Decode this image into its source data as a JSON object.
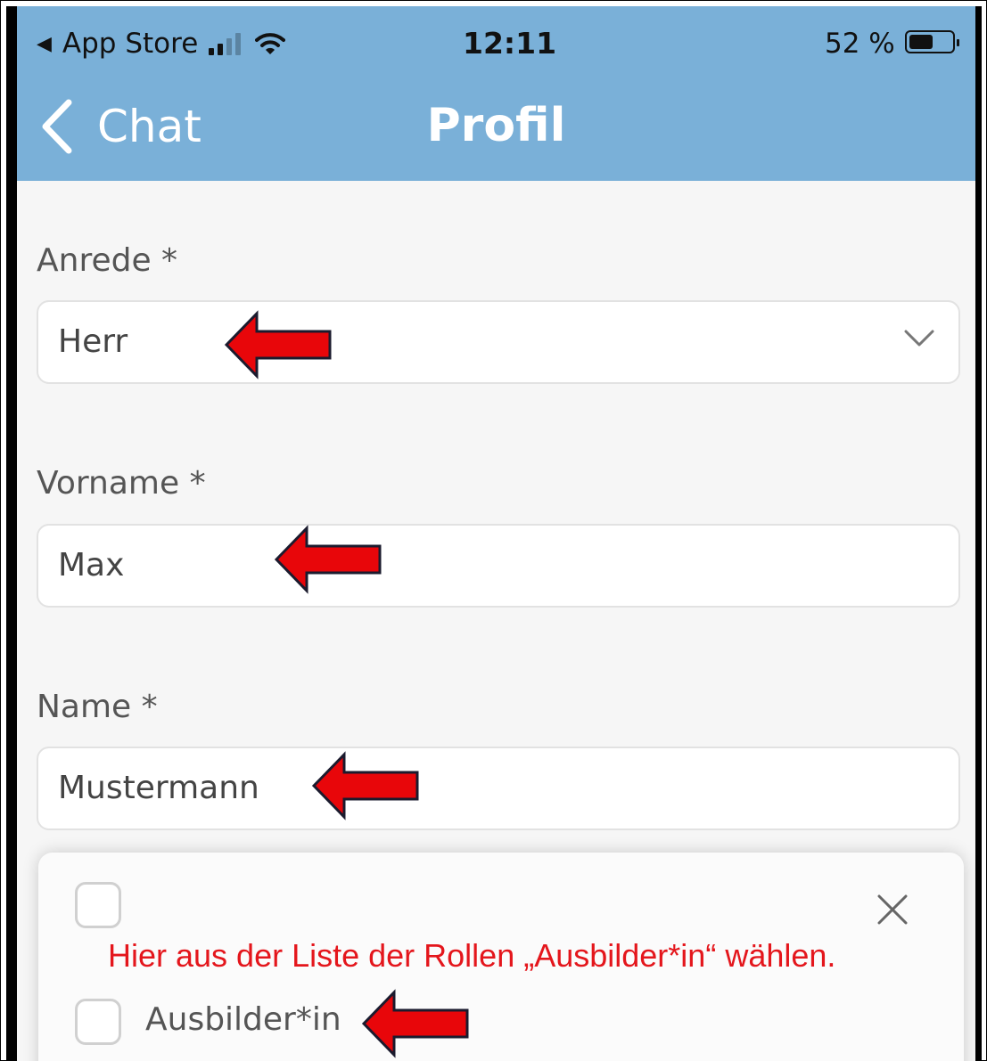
{
  "status_bar": {
    "back_app": "App Store",
    "time": "12:11",
    "battery": "52 %"
  },
  "nav": {
    "back_label": "Chat",
    "title": "Profil"
  },
  "form": {
    "salutation_label": "Anrede *",
    "salutation_value": "Herr",
    "firstname_label": "Vorname *",
    "firstname_value": "Max",
    "lastname_label": "Name *",
    "lastname_value": "Mustermann"
  },
  "roles_popup": {
    "role_option": "Ausbilder*in"
  },
  "annotation": {
    "note": "Hier aus der Liste der Rollen „Ausbilder*in“ wählen.",
    "arrow_color": "#e8060a"
  },
  "colors": {
    "header": "#7ab0d8",
    "background": "#f6f6f6"
  }
}
